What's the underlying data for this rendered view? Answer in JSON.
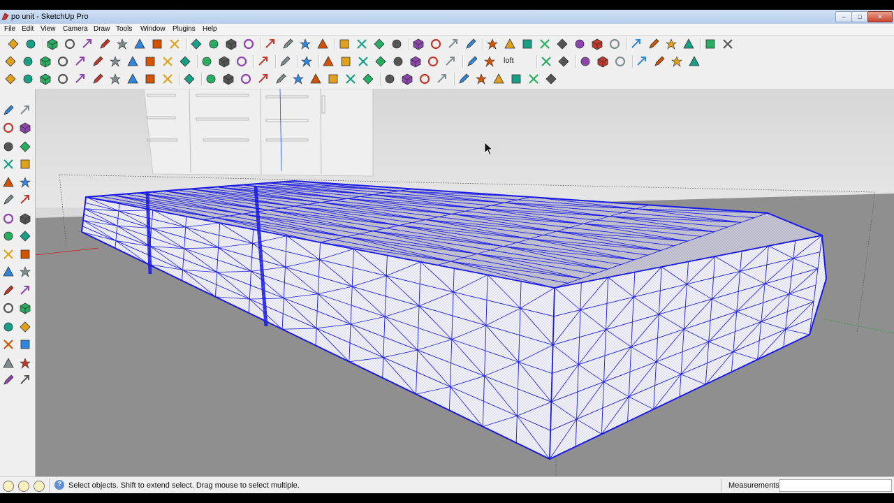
{
  "window": {
    "title": "po unit - SketchUp Pro",
    "controls": [
      "minimize",
      "maximize",
      "close"
    ]
  },
  "menu": [
    "File",
    "Edit",
    "View",
    "Camera",
    "Draw",
    "Tools",
    "Window",
    "Plugins",
    "Help"
  ],
  "toolbar": {
    "loft_label": "loft"
  },
  "status": {
    "help_glyph": "?",
    "message": "Select objects. Shift to extend select. Drag mouse to select multiple.",
    "measurements_label": "Measurements",
    "measurements_value": ""
  },
  "colors": {
    "mesh_edge": "#1a1ae6",
    "ground": "#8f8f8f",
    "sky": "#dedede",
    "face": "#f2f2fb"
  }
}
